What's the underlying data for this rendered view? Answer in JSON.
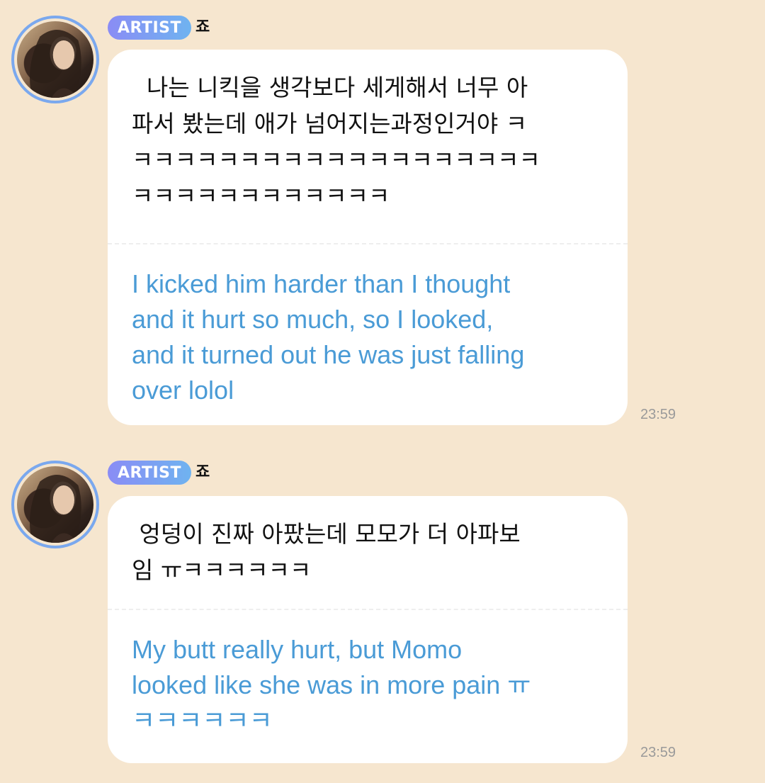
{
  "messages": [
    {
      "badge": "ARTIST",
      "author": "죠",
      "original": "  나는 니킥을 생각보다 세게해서 너무 아\n파서 봤는데 애가 넘어지는과정인거야 ㅋ\nㅋㅋㅋㅋㅋㅋㅋㅋㅋㅋㅋㅋㅋㅋㅋㅋㅋㅋㅋ\nㅋㅋㅋㅋㅋㅋㅋㅋㅋㅋㅋㅋ",
      "translated": "I kicked him harder than I thought\nand it hurt so much, so I looked,\nand it turned out he was just falling\nover lolol",
      "time": "23:59"
    },
    {
      "badge": "ARTIST",
      "author": "죠",
      "original": " 엉덩이 진짜 아팠는데 모모가 더 아파보\n임 ㅠㅋㅋㅋㅋㅋㅋ",
      "translated": "My butt really hurt, but Momo\nlooked like she was in more pain ㅠ\nㅋㅋㅋㅋㅋㅋ",
      "time": "23:59"
    }
  ],
  "icons": {
    "avatar": "profile-photo"
  },
  "colors": {
    "background": "#f6e6cf",
    "badge_start": "#8a8cf5",
    "badge_end": "#6fb3f0",
    "translation_text": "#4a9bd6",
    "timestamp": "#9a9a9a"
  }
}
